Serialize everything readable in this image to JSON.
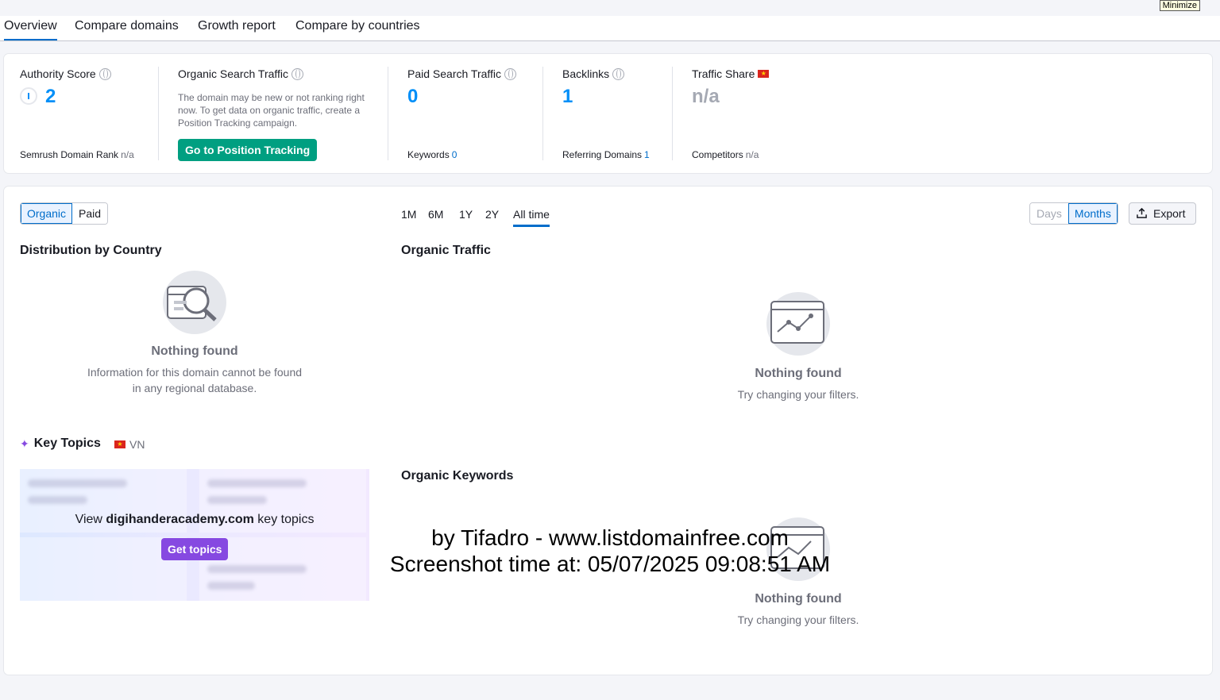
{
  "tooltip": {
    "minimize": "Minimize"
  },
  "tabs": [
    {
      "label": "Overview",
      "active": true
    },
    {
      "label": "Compare domains",
      "active": false
    },
    {
      "label": "Growth report",
      "active": false
    },
    {
      "label": "Compare by countries",
      "active": false
    }
  ],
  "metrics": {
    "authority": {
      "label": "Authority Score",
      "value": "2",
      "foot_label": "Semrush Domain Rank",
      "foot_value": "n/a"
    },
    "organic": {
      "label": "Organic Search Traffic",
      "description": "The domain may be new or not ranking right now. To get data on organic traffic, create a Position Tracking campaign.",
      "button": "Go to Position Tracking"
    },
    "paid": {
      "label": "Paid Search Traffic",
      "value": "0",
      "foot_label": "Keywords",
      "foot_value": "0"
    },
    "backlinks": {
      "label": "Backlinks",
      "value": "1",
      "foot_label": "Referring Domains",
      "foot_value": "1"
    },
    "traffic_share": {
      "label": "Traffic Share",
      "value": "n/a",
      "foot_label": "Competitors",
      "foot_value": "n/a"
    }
  },
  "controls": {
    "source": [
      {
        "label": "Organic",
        "on": true
      },
      {
        "label": "Paid",
        "on": false
      }
    ],
    "periods": [
      "1M",
      "6M",
      "1Y",
      "2Y",
      "All time"
    ],
    "active_period": "All time",
    "granularity": [
      {
        "label": "Days",
        "state": "disabled"
      },
      {
        "label": "Months",
        "state": "on"
      }
    ],
    "export": "Export"
  },
  "distribution": {
    "title": "Distribution by Country",
    "nf_title": "Nothing found",
    "nf_text": "Information for this domain cannot be found in any regional database."
  },
  "organic_traffic": {
    "title": "Organic Traffic",
    "nf_title": "Nothing found",
    "nf_text": "Try changing your filters."
  },
  "key_topics": {
    "title": "Key Topics",
    "region": "VN",
    "view_prefix": "View",
    "domain": "digihanderacademy.com",
    "view_suffix": "key topics",
    "button": "Get topics"
  },
  "organic_keywords": {
    "title": "Organic Keywords",
    "nf_title": "Nothing found",
    "nf_text": "Try changing your filters."
  },
  "watermark": {
    "line1": "by Tifadro - www.listdomainfree.com",
    "line2": "Screenshot time at: 05/07/2025 09:08:51 AM"
  },
  "theme": {
    "accent": "#006dca",
    "value_blue": "#008ff8",
    "green": "#009f81",
    "purple": "#8649e1"
  }
}
